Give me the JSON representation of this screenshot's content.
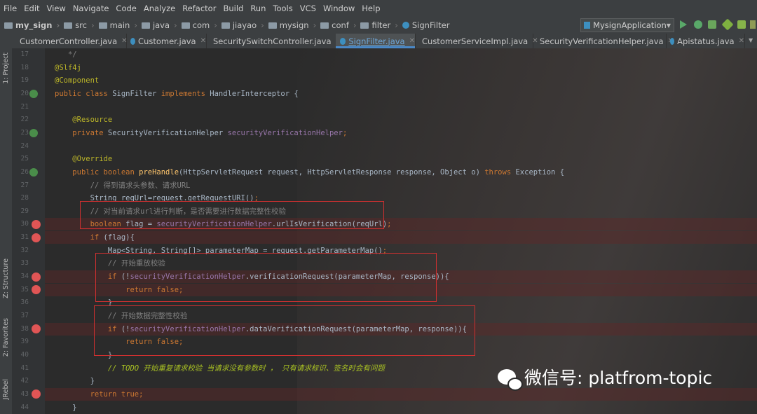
{
  "menu": [
    "File",
    "Edit",
    "View",
    "Navigate",
    "Code",
    "Analyze",
    "Refactor",
    "Build",
    "Run",
    "Tools",
    "VCS",
    "Window",
    "Help"
  ],
  "breadcrumbs": [
    "my_sign",
    "src",
    "main",
    "java",
    "com",
    "jiayao",
    "mysign",
    "conf",
    "filter",
    "SignFilter"
  ],
  "run_config": "MysignApplication",
  "tabs": [
    "CustomerController.java",
    "Customer.java",
    "SecuritySwitchController.java",
    "SignFilter.java",
    "CustomerServiceImpl.java",
    "SecurityVerificationHelper.java",
    "Apistatus.java"
  ],
  "active_tab": "SignFilter.java",
  "tool_windows": [
    "1: Project",
    "Z: Structure",
    "2: Favorites",
    "JRebel"
  ],
  "line_numbers": [
    "17",
    "18",
    "19",
    "20",
    "21",
    "22",
    "23",
    "24",
    "25",
    "26",
    "27",
    "28",
    "29",
    "30",
    "31",
    "32",
    "33",
    "34",
    "35",
    "36",
    "37",
    "38",
    "39",
    "40",
    "41",
    "42",
    "43",
    "44"
  ],
  "code": [
    [
      {
        "c": "cm",
        "t": "   */"
      }
    ],
    [
      {
        "c": "an",
        "t": "@Slf4j"
      }
    ],
    [
      {
        "c": "an",
        "t": "@Component"
      }
    ],
    [
      {
        "c": "kw",
        "t": "public class "
      },
      {
        "t": "SignFilter "
      },
      {
        "c": "kw",
        "t": "implements "
      },
      {
        "t": "HandlerInterceptor {"
      }
    ],
    [],
    [
      {
        "t": "    "
      },
      {
        "c": "an",
        "t": "@Resource"
      }
    ],
    [
      {
        "t": "    "
      },
      {
        "c": "kw",
        "t": "private "
      },
      {
        "t": "SecurityVerificationHelper "
      },
      {
        "c": "fd",
        "t": "securityVerificationHelper"
      },
      {
        "c": "kw",
        "t": ";"
      }
    ],
    [],
    [
      {
        "t": "    "
      },
      {
        "c": "an",
        "t": "@Override"
      }
    ],
    [
      {
        "t": "    "
      },
      {
        "c": "kw",
        "t": "public boolean "
      },
      {
        "c": "mt",
        "t": "preHandle"
      },
      {
        "t": "(HttpServletRequest request, HttpServletResponse response, Object o) "
      },
      {
        "c": "kw",
        "t": "throws "
      },
      {
        "t": "Exception {"
      }
    ],
    [
      {
        "t": "        "
      },
      {
        "c": "cm",
        "t": "// 得到请求头参数、请求URL"
      }
    ],
    [
      {
        "t": "        String reqUrl=request.getRequestURI()"
      },
      {
        "c": "kw",
        "t": ";"
      }
    ],
    [
      {
        "t": "        "
      },
      {
        "c": "cm",
        "t": "// 对当前请求url进行判断，是否需要进行数据完整性校验"
      }
    ],
    [
      {
        "t": "        "
      },
      {
        "c": "kw",
        "t": "boolean "
      },
      {
        "t": "flag = "
      },
      {
        "c": "fd",
        "t": "securityVerificationHelper"
      },
      {
        "t": ".urlIsVerification(reqUrl)"
      },
      {
        "c": "kw",
        "t": ";"
      }
    ],
    [
      {
        "t": "        "
      },
      {
        "c": "kw",
        "t": "if "
      },
      {
        "t": "(flag){"
      }
    ],
    [
      {
        "t": "            Map<String, String[]> parameterMap = request.getParameterMap()"
      },
      {
        "c": "kw",
        "t": ";"
      }
    ],
    [
      {
        "t": "            "
      },
      {
        "c": "cm",
        "t": "// 开始重放校验"
      }
    ],
    [
      {
        "t": "            "
      },
      {
        "c": "kw",
        "t": "if "
      },
      {
        "t": "(!"
      },
      {
        "c": "fd",
        "t": "securityVerificationHelper"
      },
      {
        "t": ".verificationRequest(parameterMap, response)){"
      }
    ],
    [
      {
        "t": "                "
      },
      {
        "c": "kw",
        "t": "return false;"
      }
    ],
    [
      {
        "t": "            }"
      }
    ],
    [
      {
        "t": "            "
      },
      {
        "c": "cm",
        "t": "// 开始数据完整性校验"
      }
    ],
    [
      {
        "t": "            "
      },
      {
        "c": "kw",
        "t": "if "
      },
      {
        "t": "(!"
      },
      {
        "c": "fd",
        "t": "securityVerificationHelper"
      },
      {
        "t": ".dataVerificationRequest(parameterMap, response)){"
      }
    ],
    [
      {
        "t": "                "
      },
      {
        "c": "kw",
        "t": "return false;"
      }
    ],
    [
      {
        "t": "            }"
      }
    ],
    [
      {
        "t": "            "
      },
      {
        "c": "td",
        "t": "// TODO 开始重复请求校验 当请求没有参数时 ， 只有请求标识、签名时会有问题"
      }
    ],
    [
      {
        "t": "        }"
      }
    ],
    [
      {
        "t": "        "
      },
      {
        "c": "kw",
        "t": "return true;"
      }
    ],
    [
      {
        "t": "    }"
      }
    ]
  ],
  "watermark": "微信号: platfrom-topic",
  "colors": {
    "breakpoint": "#e05555",
    "highlight_box": "#d03030",
    "keyword": "#cc7832",
    "annotation": "#bbb529",
    "comment": "#808080",
    "field": "#9876aa",
    "method": "#ffc66d"
  }
}
